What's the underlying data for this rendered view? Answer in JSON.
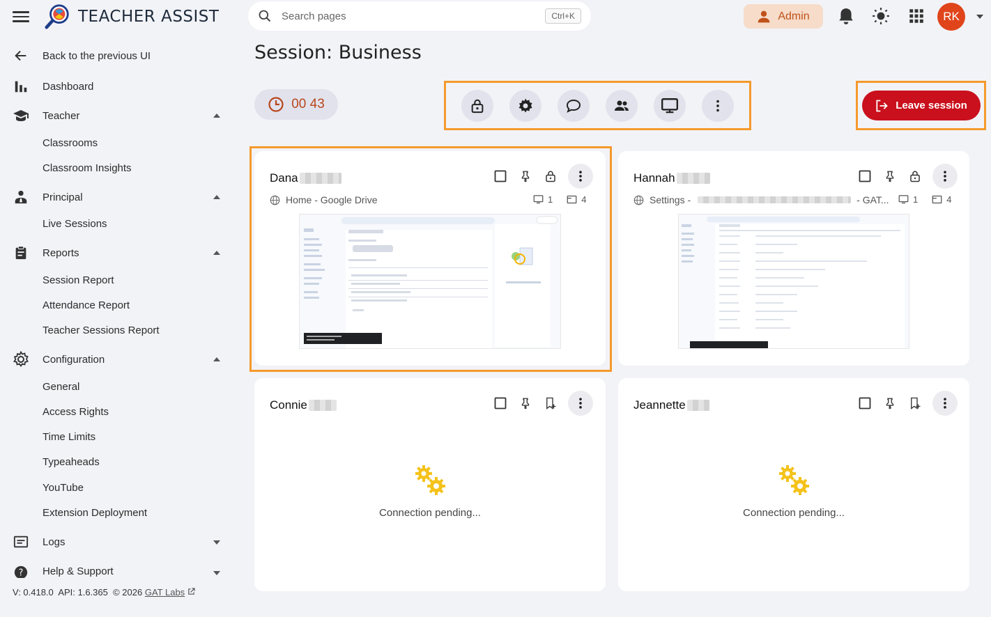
{
  "brand": {
    "title": "TEACHER ASSIST"
  },
  "sidebar": {
    "back": "Back to the previous UI",
    "dashboard": "Dashboard",
    "teacher": {
      "label": "Teacher",
      "items": [
        "Classrooms",
        "Classroom Insights"
      ]
    },
    "principal": {
      "label": "Principal",
      "items": [
        "Live Sessions"
      ]
    },
    "reports": {
      "label": "Reports",
      "items": [
        "Session Report",
        "Attendance Report",
        "Teacher Sessions Report"
      ]
    },
    "configuration": {
      "label": "Configuration",
      "items": [
        "General",
        "Access Rights",
        "Time Limits",
        "Typeaheads",
        "YouTube",
        "Extension Deployment"
      ]
    },
    "logs": "Logs",
    "help": "Help & Support"
  },
  "footer": {
    "version": "V: 0.418.0",
    "api": "API: 1.6.365",
    "copyright": "© 2026",
    "link": "GAT Labs"
  },
  "search": {
    "placeholder": "Search pages",
    "shortcut": "Ctrl+K"
  },
  "user": {
    "role": "Admin",
    "initials": "RK"
  },
  "session": {
    "title": "Session: Business",
    "timer": "00 43",
    "leave_label": "Leave session"
  },
  "students": [
    {
      "name": "Dana",
      "url_prefix": "Home - Google Drive",
      "url_suffix": "",
      "screens": "1",
      "tabs": "4",
      "status": "active"
    },
    {
      "name": "Hannah",
      "url_prefix": "Settings -",
      "url_suffix": "- GAT...",
      "screens": "1",
      "tabs": "4",
      "status": "active"
    },
    {
      "name": "Connie",
      "status": "Connection pending..."
    },
    {
      "name": "Jeannette",
      "status": "Connection pending..."
    }
  ],
  "colors": {
    "accent": "#f59a2c",
    "danger": "#c9101c",
    "brand_orange": "#e0441b"
  }
}
